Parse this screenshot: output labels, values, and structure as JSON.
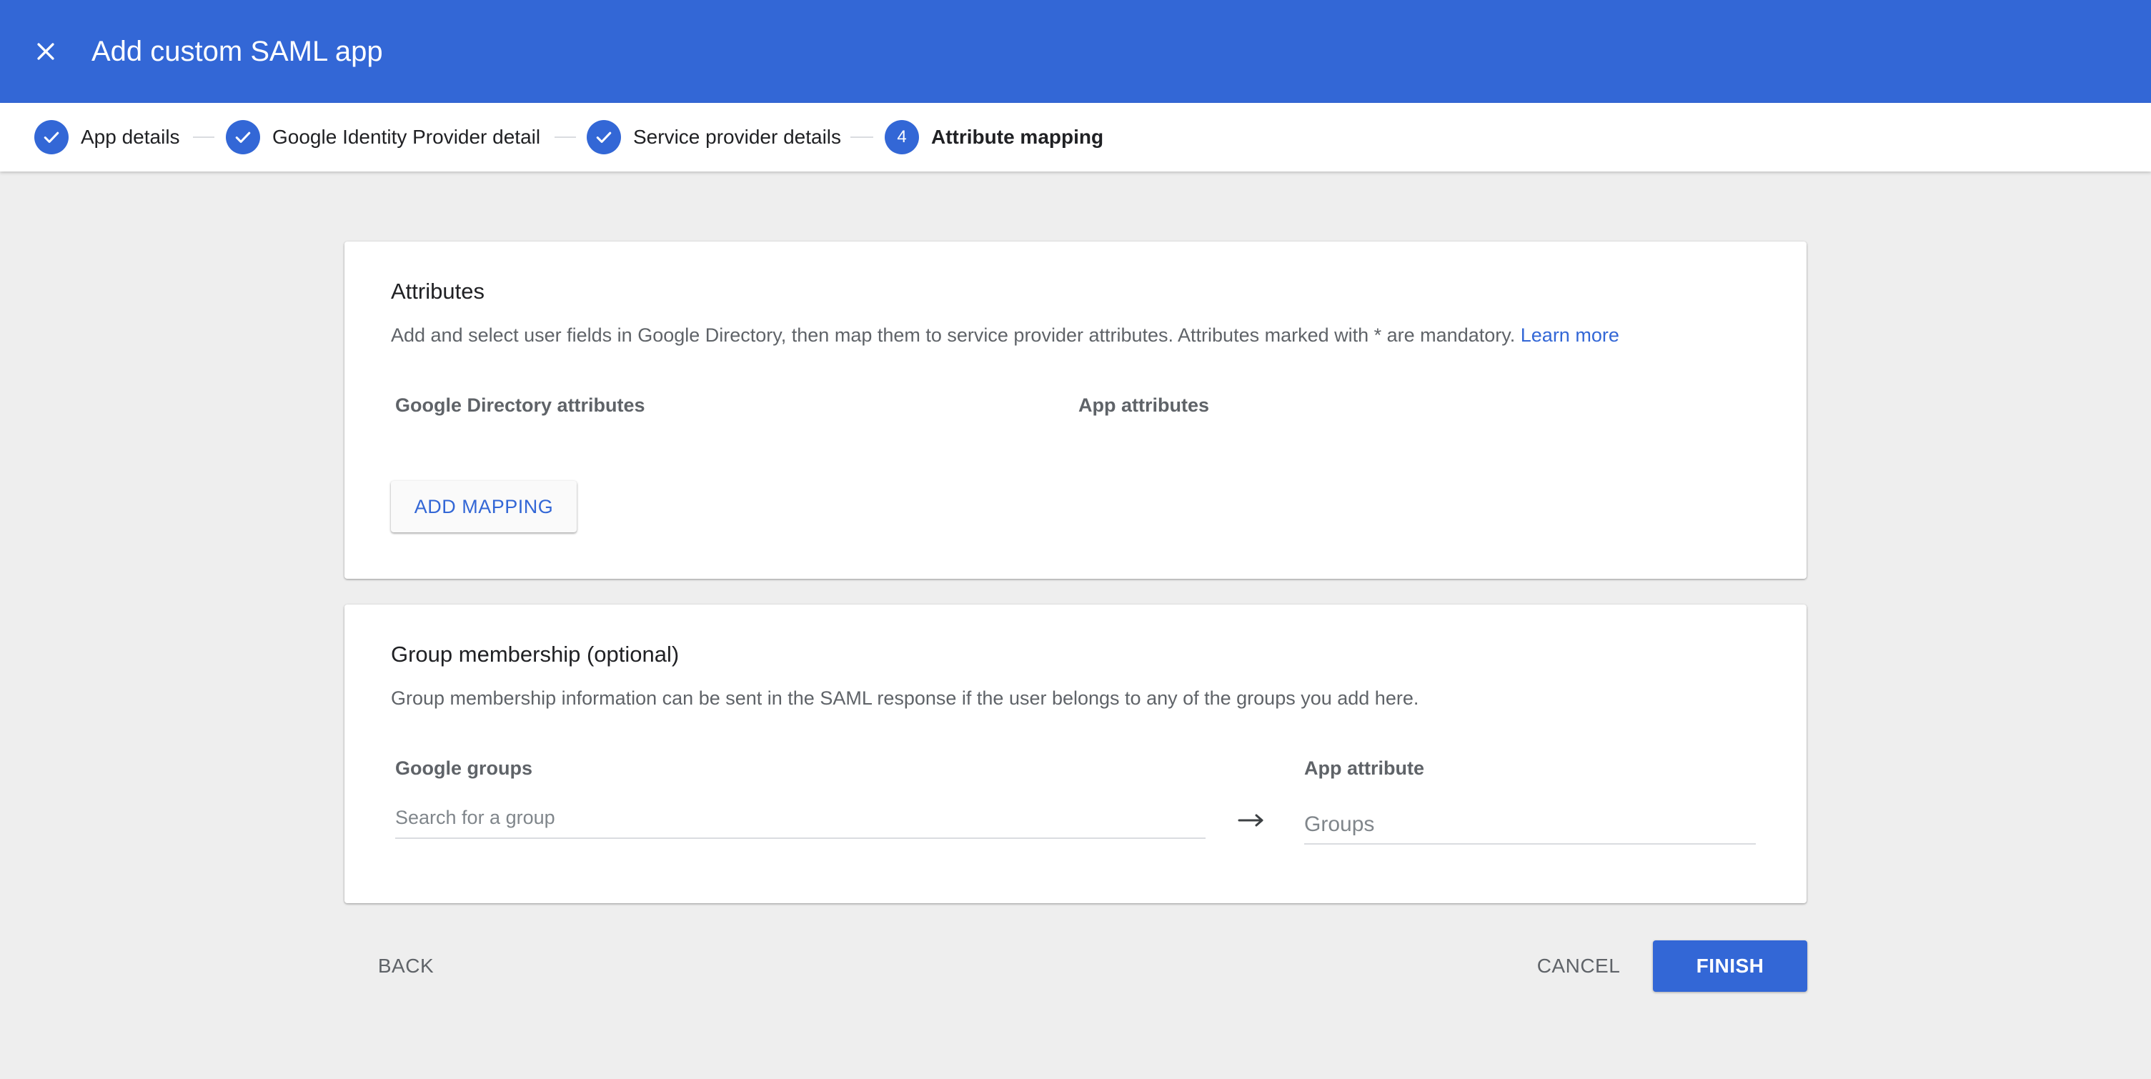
{
  "header": {
    "close_icon": "close-icon",
    "title": "Add custom SAML app",
    "background_color": "#3367d6"
  },
  "stepper": {
    "steps": [
      {
        "label": "App details",
        "state": "completed",
        "icon": "check-icon"
      },
      {
        "label": "Google Identity Provider details",
        "state": "completed",
        "icon": "check-icon"
      },
      {
        "label": "Service provider details",
        "state": "completed",
        "icon": "check-icon"
      },
      {
        "label": "Attribute mapping",
        "state": "active",
        "number": "4"
      }
    ]
  },
  "attributes_card": {
    "title": "Attributes",
    "description": "Add and select user fields in Google Directory, then map them to service provider attributes. Attributes marked with * are mandatory.",
    "learn_more": "Learn more",
    "col_directory": "Google Directory attributes",
    "col_app": "App attributes",
    "add_mapping_label": "ADD MAPPING"
  },
  "group_card": {
    "title": "Group membership (optional)",
    "description": "Group membership information can be sent in the SAML response if the user belongs to any of the groups you add here.",
    "col_groups": "Google groups",
    "col_app_attribute": "App attribute",
    "search_placeholder": "Search for a group",
    "app_attribute_placeholder": "Groups",
    "arrow_icon": "arrow-right-icon"
  },
  "footer": {
    "back_label": "BACK",
    "cancel_label": "CANCEL",
    "finish_label": "FINISH"
  }
}
